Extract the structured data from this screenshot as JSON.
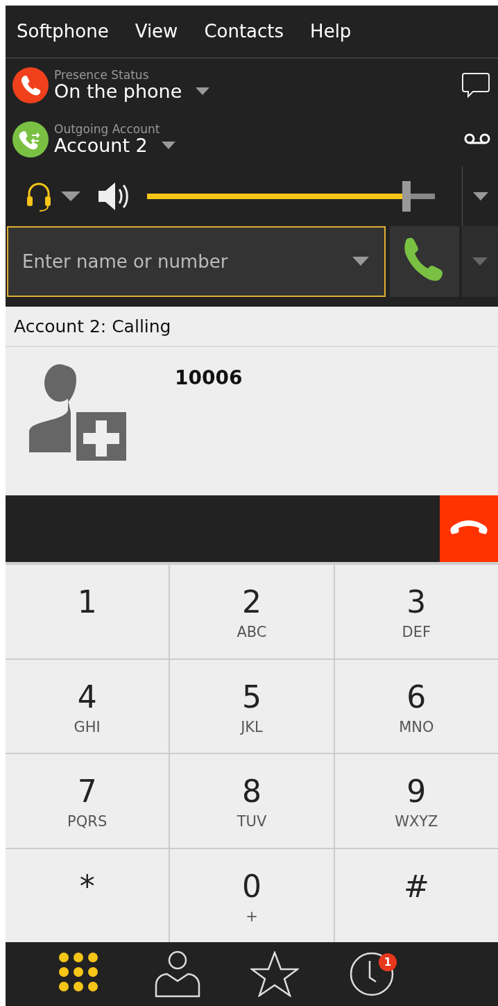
{
  "menu": [
    "Softphone",
    "View",
    "Contacts",
    "Help"
  ],
  "presence": {
    "label": "Presence Status",
    "value": "On the phone"
  },
  "account": {
    "label": "Outgoing Account",
    "value": "Account 2"
  },
  "volume": {
    "level": 0.9
  },
  "dial": {
    "placeholder": "Enter name or number"
  },
  "call": {
    "status": "Account 2: Calling",
    "number": "10006"
  },
  "keypad": [
    {
      "digit": "1"
    },
    {
      "digit": "2",
      "letters": "ABC"
    },
    {
      "digit": "3",
      "letters": "DEF"
    },
    {
      "digit": "4",
      "letters": "GHI"
    },
    {
      "digit": "5",
      "letters": "JKL"
    },
    {
      "digit": "6",
      "letters": "MNO"
    },
    {
      "digit": "7",
      "letters": "PQRS"
    },
    {
      "digit": "8",
      "letters": "TUV"
    },
    {
      "digit": "9",
      "letters": "WXYZ"
    },
    {
      "digit": "*"
    },
    {
      "digit": "0",
      "letters": "+"
    },
    {
      "digit": "#"
    }
  ],
  "nav": [
    {
      "kind": "dialpad",
      "selected": true
    },
    {
      "kind": "contacts",
      "selected": false
    },
    {
      "kind": "favorites",
      "selected": false
    },
    {
      "kind": "history",
      "selected": false,
      "badge": "1"
    }
  ]
}
